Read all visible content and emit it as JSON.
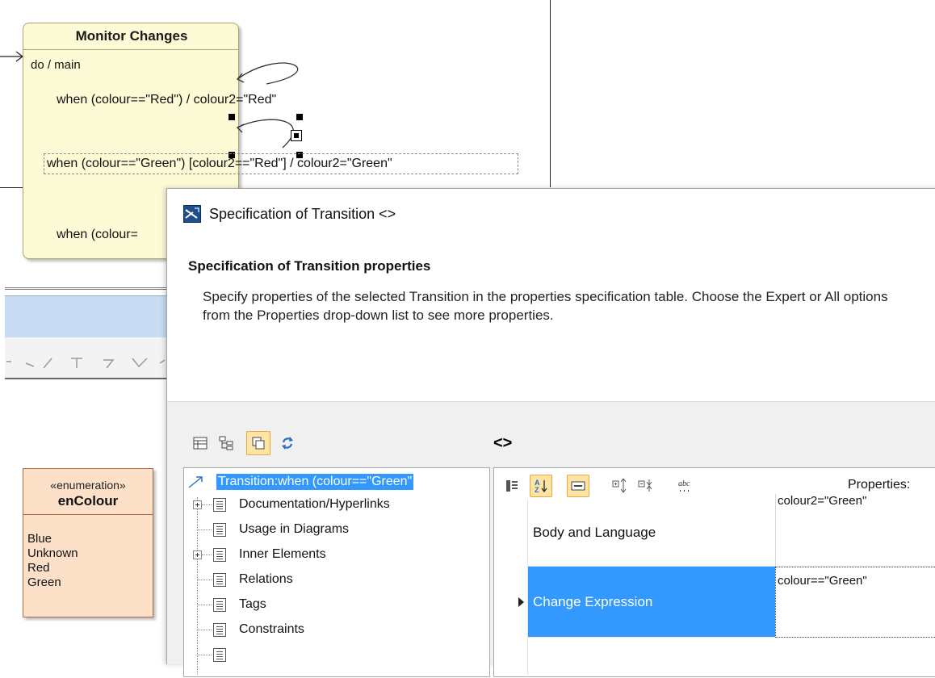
{
  "diagram": {
    "state": {
      "title": "Monitor Changes",
      "do_action": "do / main",
      "transition1": "when (colour==\"Red\") / colour2=\"Red\"",
      "transition2": "when (colour==\"Green\") [colour2==\"Red\"] / colour2=\"Green\"",
      "transition3": "when (colour="
    },
    "enumeration": {
      "stereotype": "«enumeration»",
      "name": "enColour",
      "literals": [
        "Blue",
        "Unknown",
        "Red",
        "Green"
      ]
    }
  },
  "dialog": {
    "window_title": "Specification of Transition <>",
    "header_title": "Specification of Transition properties",
    "header_desc": "Specify properties of the selected Transition in the properties specification table. Choose the Expert or All options from the Properties drop-down list to see more properties.",
    "tree": {
      "root": "Transition:when (colour==\"Green\"",
      "items": [
        {
          "label": "Documentation/Hyperlinks",
          "expandable": true
        },
        {
          "label": "Usage in Diagrams",
          "expandable": false
        },
        {
          "label": "Inner Elements",
          "expandable": true
        },
        {
          "label": "Relations",
          "expandable": false
        },
        {
          "label": "Tags",
          "expandable": false
        },
        {
          "label": "Constraints",
          "expandable": false
        }
      ]
    },
    "properties": {
      "title": "<>",
      "toolbar_label": "Properties:",
      "rows": [
        {
          "name": "Body and Language",
          "value": "colour2=\"Green\""
        },
        {
          "name": "Change Expression",
          "value": "colour==\"Green\""
        }
      ]
    }
  },
  "colors": {
    "selection": "#3399ff",
    "state_fill": "#fdfbd6",
    "enum_fill": "#fce1c8",
    "active_button": "#fde3a4"
  }
}
